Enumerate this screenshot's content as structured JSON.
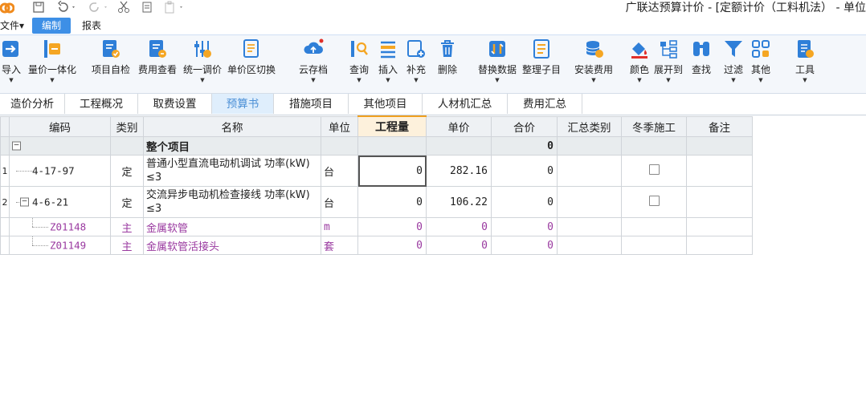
{
  "app": {
    "title": "广联达预算计价 - [定额计价（工料机法） - 单位"
  },
  "menu": {
    "items": [
      {
        "label": "文件▾"
      },
      {
        "label": "编制"
      },
      {
        "label": "报表"
      }
    ]
  },
  "ribbon": {
    "buttons": [
      {
        "label": "导入",
        "icon": "import-icon"
      },
      {
        "label": "量价一体化",
        "icon": "integration-icon"
      },
      {
        "label": "项目自检",
        "icon": "self-check-icon"
      },
      {
        "label": "费用查看",
        "icon": "fee-view-icon"
      },
      {
        "label": "统一调价",
        "icon": "adjust-price-icon"
      },
      {
        "label": "单价区切换",
        "icon": "unit-price-switch-icon"
      },
      {
        "label": "云存档",
        "icon": "cloud-archive-icon"
      },
      {
        "label": "查询",
        "icon": "query-icon"
      },
      {
        "label": "插入",
        "icon": "insert-icon"
      },
      {
        "label": "补充",
        "icon": "supplement-icon"
      },
      {
        "label": "删除",
        "icon": "delete-icon"
      },
      {
        "label": "替换数据",
        "icon": "replace-data-icon"
      },
      {
        "label": "整理子目",
        "icon": "organize-icon"
      },
      {
        "label": "安装费用",
        "icon": "install-fee-icon"
      },
      {
        "label": "颜色",
        "icon": "color-icon"
      },
      {
        "label": "展开到",
        "icon": "expand-to-icon"
      },
      {
        "label": "查找",
        "icon": "find-icon"
      },
      {
        "label": "过滤",
        "icon": "filter-icon"
      },
      {
        "label": "其他",
        "icon": "other-icon"
      },
      {
        "label": "工具",
        "icon": "tools-icon"
      }
    ]
  },
  "subtabs": [
    {
      "label": "造价分析"
    },
    {
      "label": "工程概况"
    },
    {
      "label": "取费设置"
    },
    {
      "label": "预算书"
    },
    {
      "label": "措施项目"
    },
    {
      "label": "其他项目"
    },
    {
      "label": "人材机汇总"
    },
    {
      "label": "费用汇总"
    }
  ],
  "table": {
    "headers": [
      "编码",
      "类别",
      "名称",
      "单位",
      "工程量",
      "单价",
      "合价",
      "汇总类别",
      "冬季施工",
      "备注"
    ],
    "section": {
      "name": "整个项目",
      "total": "0"
    },
    "rows": [
      {
        "no": "1",
        "code": "4-17-97",
        "type": "定",
        "name": "普通小型直流电动机调试 功率(kW) ≤3",
        "unit": "台",
        "qty": "0",
        "price": "282.16",
        "total": "0"
      },
      {
        "no": "2",
        "code": "4-6-21",
        "type": "定",
        "name": "交流异步电动机检查接线 功率(kW) ≤3",
        "unit": "台",
        "qty": "0",
        "price": "106.22",
        "total": "0"
      },
      {
        "code": "Z01148",
        "type": "主",
        "name": "金属软管",
        "unit": "m",
        "qty": "0",
        "price": "0",
        "total": "0"
      },
      {
        "code": "Z01149",
        "type": "主",
        "name": "金属软管活接头",
        "unit": "套",
        "qty": "0",
        "price": "0",
        "total": "0"
      }
    ]
  },
  "colors": {
    "accent": "#3d8fe6",
    "sub_row_text": "#9a3aa0",
    "active_subtab_text": "#4a8fd6"
  }
}
